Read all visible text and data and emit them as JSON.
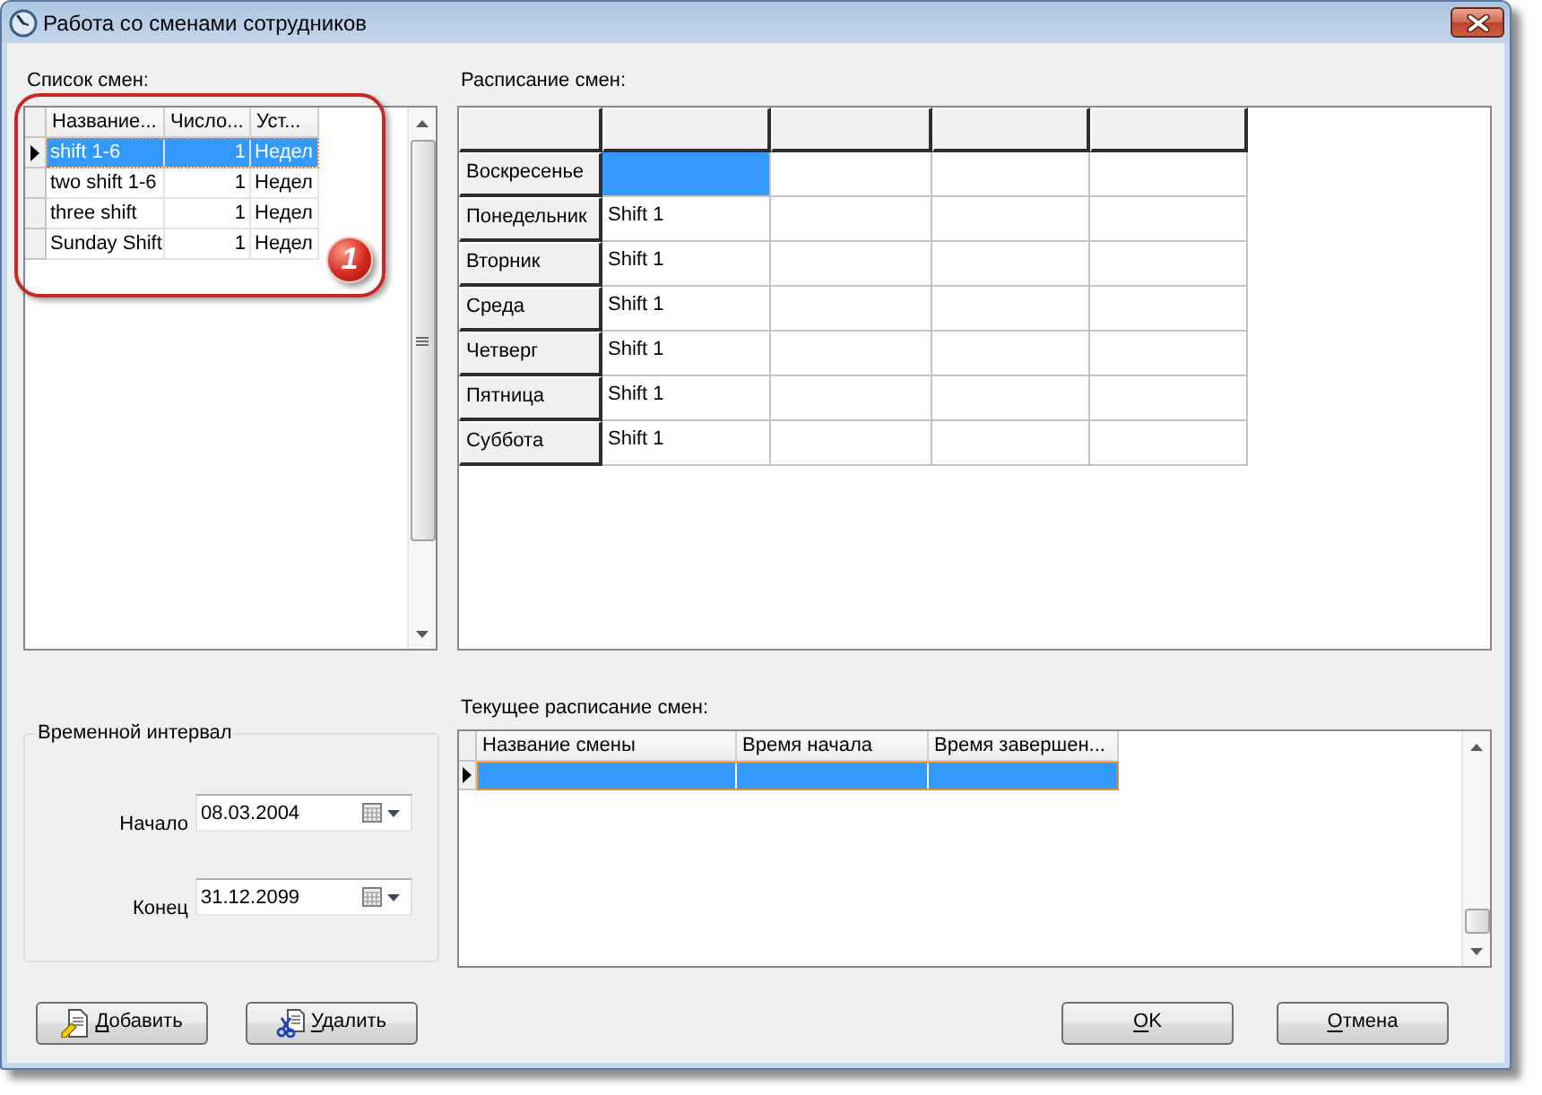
{
  "window": {
    "title": "Работа со сменами сотрудников"
  },
  "shift_list": {
    "label": "Список смен:",
    "columns": [
      "Название...",
      "Число...",
      "Уст..."
    ],
    "rows": [
      {
        "cells": [
          "shift 1-6",
          "1",
          "Недел"
        ],
        "selected": true
      },
      {
        "cells": [
          "two shift 1-6",
          "1",
          "Недел"
        ],
        "selected": false
      },
      {
        "cells": [
          "three shift",
          "1",
          "Недел"
        ],
        "selected": false
      },
      {
        "cells": [
          "Sunday Shift",
          "1",
          "Недел"
        ],
        "selected": false
      }
    ]
  },
  "annotation": {
    "badge": "1"
  },
  "schedule": {
    "label": "Расписание смен:",
    "rows": [
      {
        "day": "Воскресенье",
        "cells": [
          {
            "selected": true
          },
          {
            "selected": false
          },
          {
            "selected": false
          },
          {
            "selected": false
          }
        ]
      },
      {
        "day": "Понедельник",
        "cells": [
          {
            "text": "Shift 1",
            "selected": false
          },
          {
            "selected": false
          },
          {
            "selected": false
          },
          {
            "selected": false
          }
        ]
      },
      {
        "day": "Вторник",
        "cells": [
          {
            "text": "Shift 1",
            "selected": false
          },
          {
            "selected": false
          },
          {
            "selected": false
          },
          {
            "selected": false
          }
        ]
      },
      {
        "day": "Среда",
        "cells": [
          {
            "text": "Shift 1",
            "selected": false
          },
          {
            "selected": false
          },
          {
            "selected": false
          },
          {
            "selected": false
          }
        ]
      },
      {
        "day": "Четверг",
        "cells": [
          {
            "text": "Shift 1",
            "selected": false
          },
          {
            "selected": false
          },
          {
            "selected": false
          },
          {
            "selected": false
          }
        ]
      },
      {
        "day": "Пятница",
        "cells": [
          {
            "text": "Shift 1",
            "selected": false
          },
          {
            "selected": false
          },
          {
            "selected": false
          },
          {
            "selected": false
          }
        ]
      },
      {
        "day": "Суббота",
        "cells": [
          {
            "text": "Shift 1",
            "selected": false
          },
          {
            "selected": false
          },
          {
            "selected": false
          },
          {
            "selected": false
          }
        ]
      }
    ]
  },
  "time_interval": {
    "title": "Временной интервал",
    "fields": [
      {
        "label": "Начало",
        "value": "08.03.2004"
      },
      {
        "label": "Конец",
        "value": "31.12.2099"
      }
    ]
  },
  "current_schedule": {
    "label": "Текущее расписание смен:",
    "columns": [
      "Название смены",
      "Время начала",
      "Время завершен..."
    ],
    "rows": [
      {
        "selected": true
      }
    ]
  },
  "actions": [
    {
      "label": "Добавить",
      "kind": "add",
      "mnemonic": true
    },
    {
      "label": "Удалить",
      "kind": "delete",
      "mnemonic": true
    }
  ],
  "dialog_buttons": [
    {
      "label": "OK",
      "mnemonic": true
    },
    {
      "label": "Отмена",
      "mnemonic": true
    }
  ]
}
